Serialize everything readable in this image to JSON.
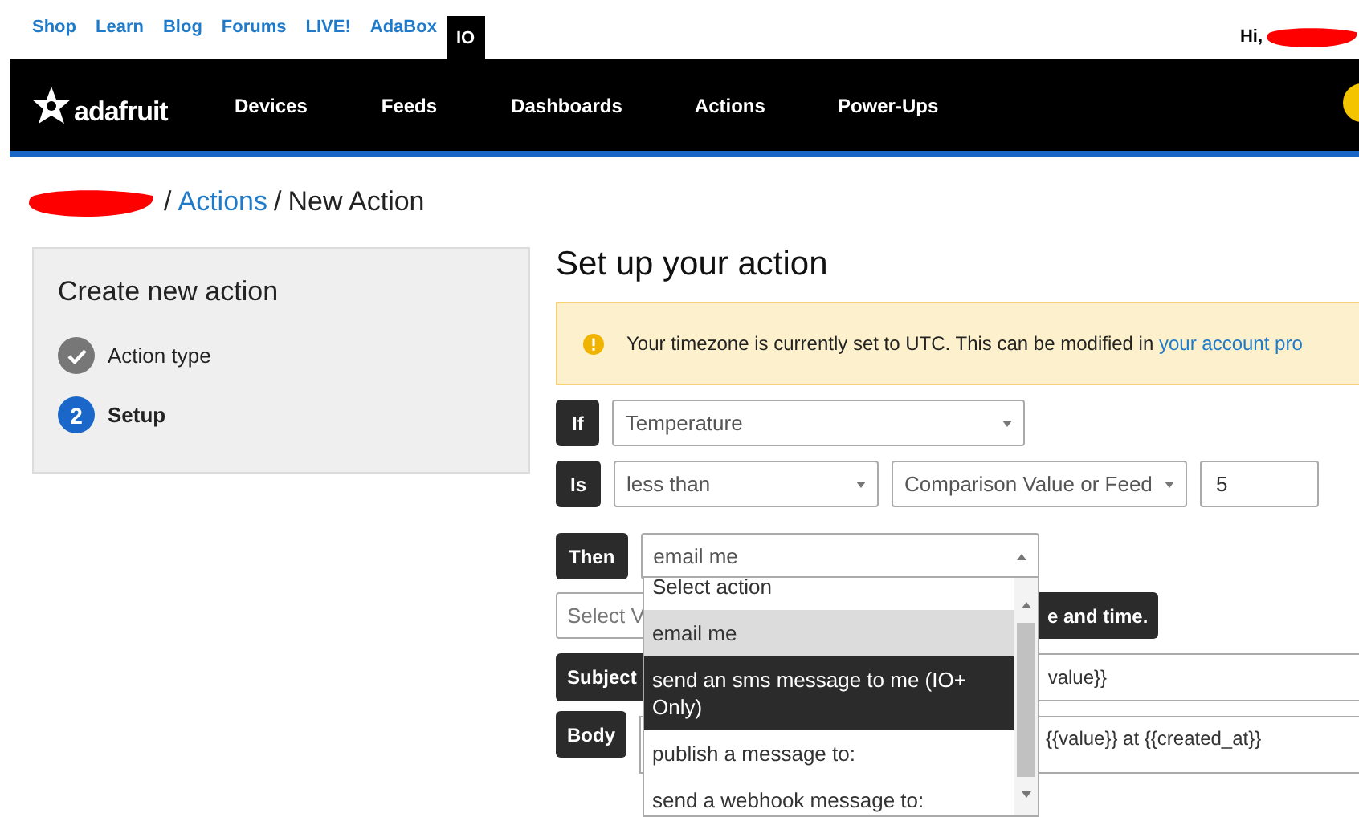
{
  "top_nav": {
    "links": [
      {
        "label": "Shop",
        "selected": false
      },
      {
        "label": "Learn",
        "selected": false
      },
      {
        "label": "Blog",
        "selected": false
      },
      {
        "label": "Forums",
        "selected": false
      },
      {
        "label": "LIVE!",
        "selected": false
      },
      {
        "label": "AdaBox",
        "selected": false
      },
      {
        "label": "IO",
        "selected": true
      }
    ],
    "greeting": "Hi,"
  },
  "header": {
    "logo": "adafruit",
    "nav": [
      "Devices",
      "Feeds",
      "Dashboards",
      "Actions",
      "Power-Ups"
    ]
  },
  "breadcrumb": [
    {
      "separator": "/",
      "label": "Actions",
      "kind": "link"
    },
    {
      "separator": "/",
      "label": "New Action",
      "kind": "current"
    }
  ],
  "wizard": {
    "title": "Create new action",
    "steps": [
      {
        "label": "Action type",
        "done": true,
        "selected": false
      },
      {
        "number": "2",
        "label": "Setup",
        "done": false,
        "selected": true
      }
    ]
  },
  "form": {
    "title": "Set up your action",
    "notice": {
      "text": "Your timezone is currently set to UTC. This can be modified in ",
      "link": "your account pro"
    },
    "if_row": {
      "label": "If",
      "select": "Temperature"
    },
    "is_row": {
      "label": "Is",
      "operator": "less than",
      "comparison": "Comparison Value or Feed",
      "value": "5"
    },
    "then_row": {
      "label": "Then",
      "select": "email me",
      "expanded": true,
      "options": [
        {
          "label": "Select action",
          "selected": false,
          "highlighted": false
        },
        {
          "label": "email me",
          "selected": true,
          "highlighted": false
        },
        {
          "label": "send an sms message to me (IO+ Only)",
          "selected": false,
          "highlighted": true
        },
        {
          "label": "publish a message to:",
          "selected": false,
          "highlighted": false
        },
        {
          "label": "send a webhook message to:",
          "selected": false,
          "highlighted": false
        }
      ]
    },
    "schedule_row": {
      "field": "Select V",
      "button": "e and time."
    },
    "subject_row": {
      "label": "Subject",
      "value": "value}}"
    },
    "body_row": {
      "label": "Body",
      "value": "{{value}} at {{created_at}}"
    }
  }
}
